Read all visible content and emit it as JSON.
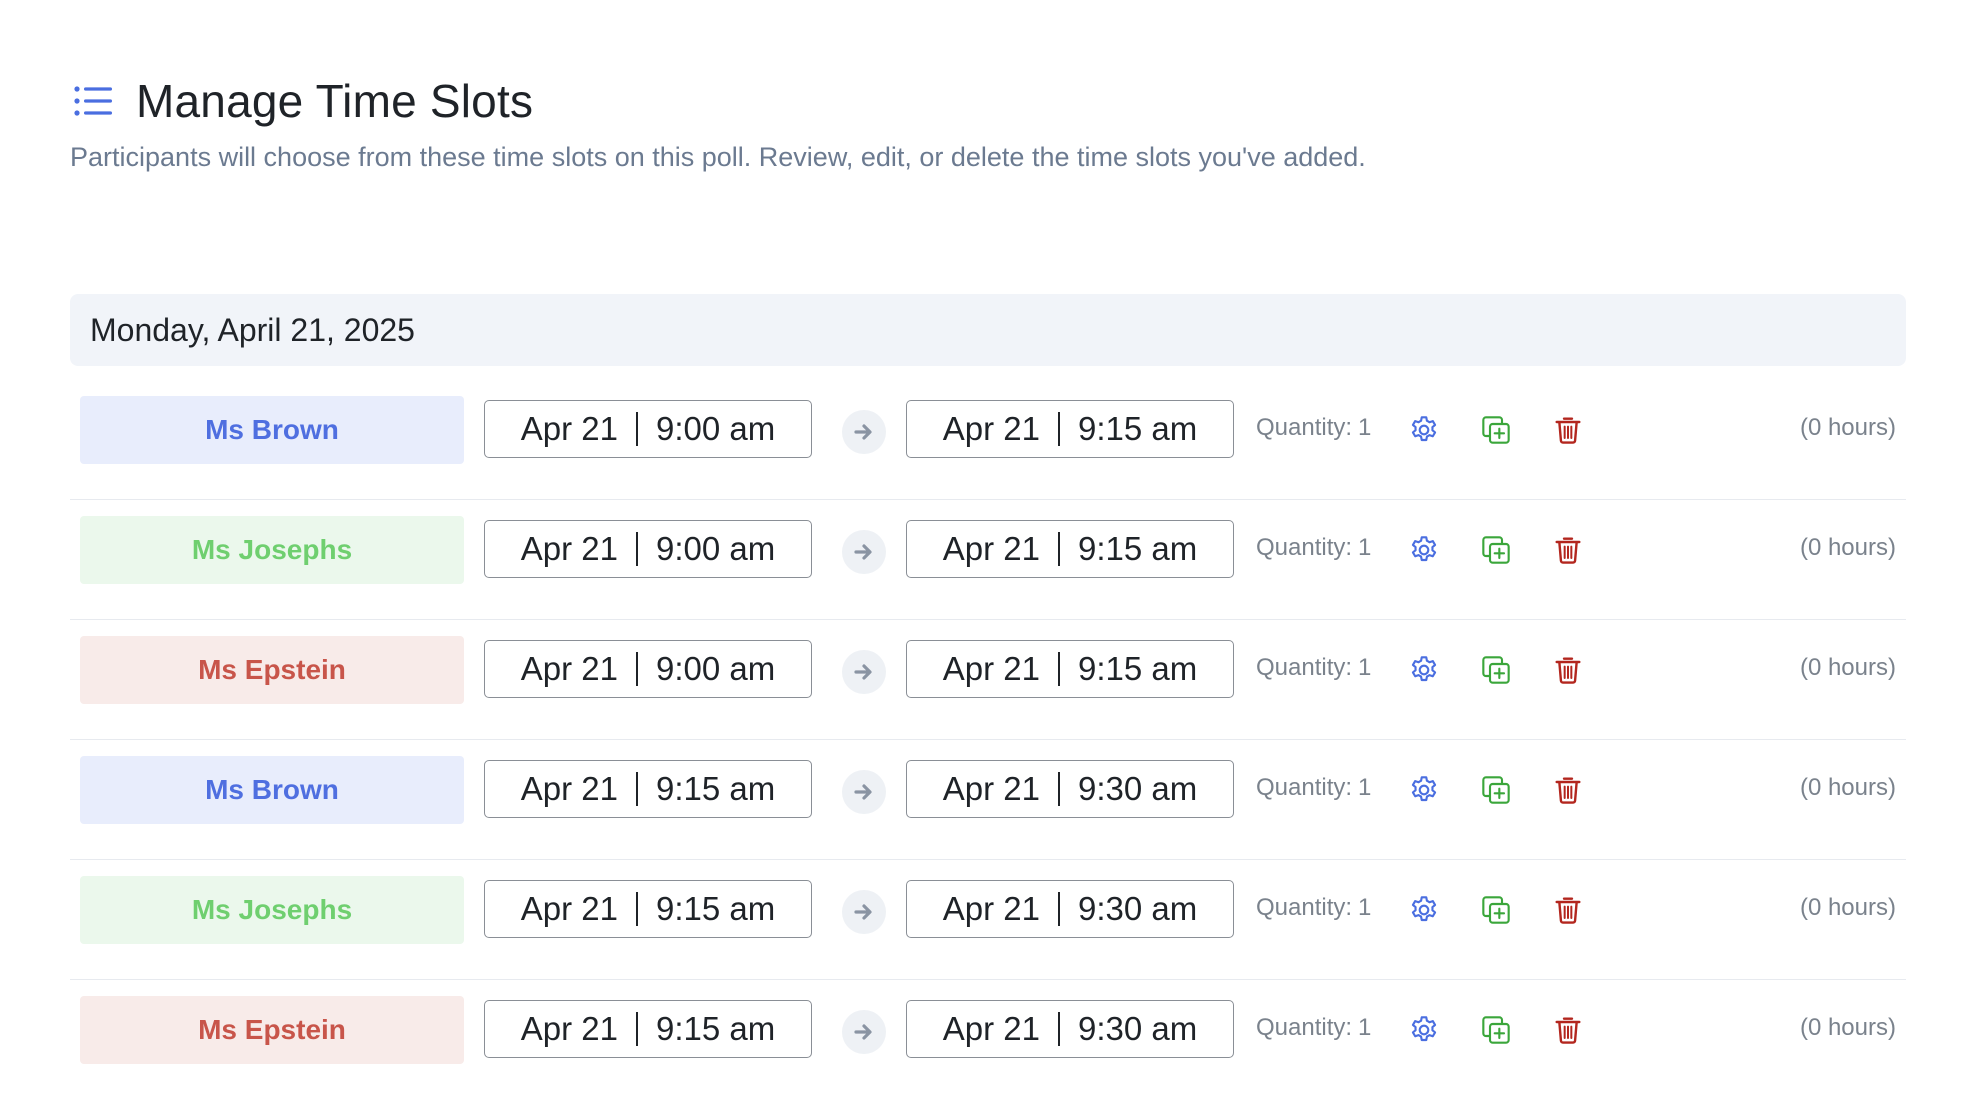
{
  "header": {
    "icon": "list-icon",
    "title": "Manage Time Slots",
    "subtitle": "Participants will choose from these time slots on this poll. Review, edit, or delete the time slots you've added."
  },
  "colors": {
    "accent": "#4a6ee0",
    "brown_bg": "#e8edfc",
    "brown_text": "#4f6fe0",
    "josephs_bg": "#ebf8ec",
    "josephs_text": "#6fcf6f",
    "epstein_bg": "#f8ebe9",
    "epstein_text": "#c8554a",
    "gear": "#4a6ee0",
    "duplicate": "#3ba63b",
    "trash": "#b3261e"
  },
  "day": {
    "label": "Monday, April 21, 2025",
    "slots": [
      {
        "teacher": "Ms Brown",
        "theme": "brown",
        "start_date": "Apr 21",
        "start_time": "9:00 am",
        "end_date": "Apr 21",
        "end_time": "9:15 am",
        "quantity_label": "Quantity:",
        "quantity": "1",
        "hours": "(0 hours)"
      },
      {
        "teacher": "Ms Josephs",
        "theme": "josephs",
        "start_date": "Apr 21",
        "start_time": "9:00 am",
        "end_date": "Apr 21",
        "end_time": "9:15 am",
        "quantity_label": "Quantity:",
        "quantity": "1",
        "hours": "(0 hours)"
      },
      {
        "teacher": "Ms Epstein",
        "theme": "epstein",
        "start_date": "Apr 21",
        "start_time": "9:00 am",
        "end_date": "Apr 21",
        "end_time": "9:15 am",
        "quantity_label": "Quantity:",
        "quantity": "1",
        "hours": "(0 hours)"
      },
      {
        "teacher": "Ms Brown",
        "theme": "brown",
        "start_date": "Apr 21",
        "start_time": "9:15 am",
        "end_date": "Apr 21",
        "end_time": "9:30 am",
        "quantity_label": "Quantity:",
        "quantity": "1",
        "hours": "(0 hours)"
      },
      {
        "teacher": "Ms Josephs",
        "theme": "josephs",
        "start_date": "Apr 21",
        "start_time": "9:15 am",
        "end_date": "Apr 21",
        "end_time": "9:30 am",
        "quantity_label": "Quantity:",
        "quantity": "1",
        "hours": "(0 hours)"
      },
      {
        "teacher": "Ms Epstein",
        "theme": "epstein",
        "start_date": "Apr 21",
        "start_time": "9:15 am",
        "end_date": "Apr 21",
        "end_time": "9:30 am",
        "quantity_label": "Quantity:",
        "quantity": "1",
        "hours": "(0 hours)"
      }
    ]
  }
}
